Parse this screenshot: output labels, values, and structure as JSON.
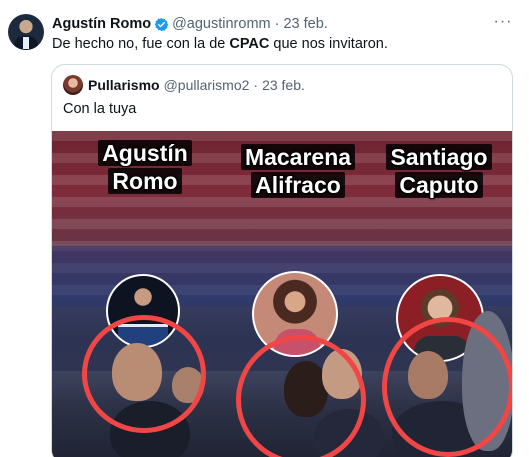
{
  "tweet": {
    "author_name": "Agustín Romo",
    "author_handle": "@agustinromm",
    "separator": "·",
    "date": "23 feb.",
    "more_label": "···",
    "text_before": "De hecho no, fue con la de ",
    "text_bold": "CPAC",
    "text_after": " que nos invitaron."
  },
  "quote": {
    "author_name": "Pullarismo",
    "author_handle": "@pullarismo2",
    "separator": "·",
    "date": "23 feb.",
    "text": "Con la tuya",
    "media_labels": [
      {
        "line1": "Agustín",
        "line2": "Romo"
      },
      {
        "line1": "Macarena",
        "line2": "Alifraco"
      },
      {
        "line1": "Santiago",
        "line2": "Caputo"
      }
    ]
  },
  "colors": {
    "text_primary": "#0f1419",
    "text_secondary": "#536471",
    "verified_blue": "#1d9bf0",
    "border": "#cfd9de",
    "highlight_ring": "#f04646"
  },
  "icons": {
    "verified": "verified-badge-icon",
    "more": "more-options-icon"
  }
}
